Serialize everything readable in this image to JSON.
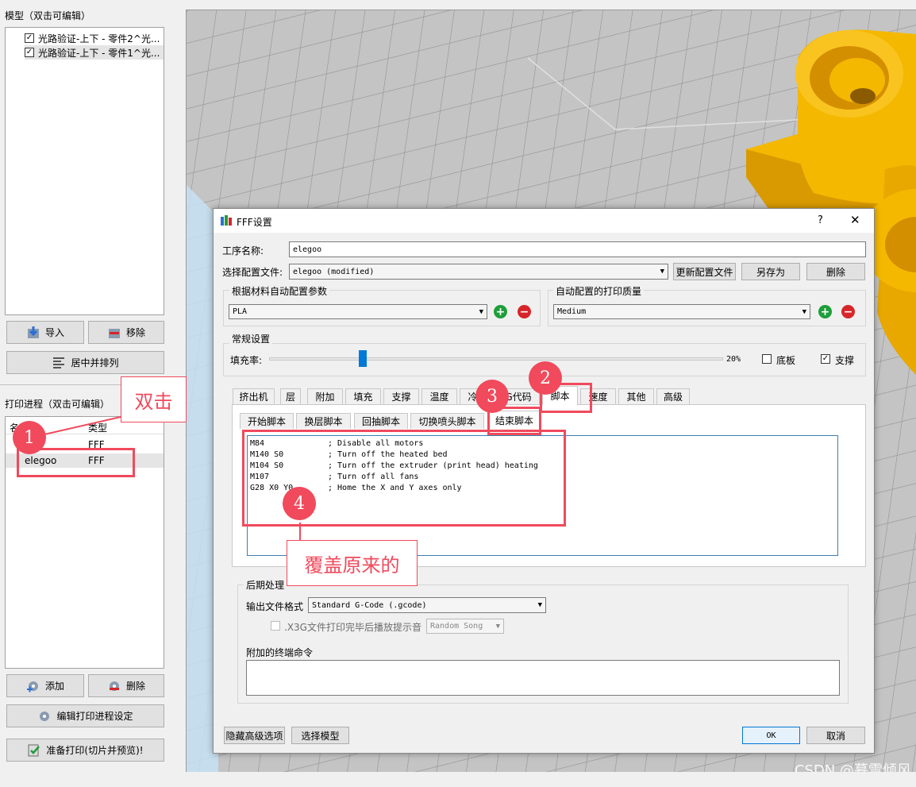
{
  "left": {
    "models_title": "模型（双击可编辑）",
    "models": [
      {
        "label": "光路验证-上下 - 零件2^光...",
        "checked": "✓"
      },
      {
        "label": "光路验证-上下 - 零件1^光...",
        "checked": "✓"
      }
    ],
    "import_label": "导入",
    "remove_label": "移除",
    "center_arrange_label": "居中并排列",
    "process_title": "打印进程（双击可编辑）",
    "process_columns": [
      "名",
      "类型"
    ],
    "processes": [
      {
        "name": "",
        "type": "FFF"
      },
      {
        "name": "elegoo",
        "type": "FFF"
      }
    ],
    "add_label": "添加",
    "delete_label": "删除",
    "edit_process_label": "编辑打印进程设定",
    "prepare_print_label": "准备打印(切片并预览)!"
  },
  "dialog": {
    "title": "FFF设置",
    "help": "?",
    "close": "✕",
    "process_name_label": "工序名称:",
    "process_name_value": "elegoo",
    "config_label": "选择配置文件:",
    "config_value": "elegoo (modified)",
    "update_config_label": "更新配置文件",
    "save_as_label": "另存为",
    "delete_label": "删除",
    "material_group": "根据材料自动配置参数",
    "material_value": "PLA",
    "quality_group": "自动配置的打印质量",
    "quality_value": "Medium",
    "general_group": "常规设置",
    "infill_label": "填充率:",
    "infill_slider_fraction": 0.206,
    "infill_value": "20%",
    "raft_label": "底板",
    "raft_checked": "",
    "support_label": "支撑",
    "support_checked": "✓",
    "main_tabs": [
      "挤出机",
      "层",
      "附加",
      "填充",
      "支撑",
      "温度",
      "冷却",
      "G代码",
      "脚本",
      "速度",
      "其他",
      "高级"
    ],
    "script_tabs": [
      "开始脚本",
      "换层脚本",
      "回抽脚本",
      "切换喷头脚本",
      "结束脚本"
    ],
    "script_lines": [
      {
        "cmd": "M84",
        "comment": "; Disable all motors"
      },
      {
        "cmd": "M140 S0",
        "comment": "; Turn off the heated bed"
      },
      {
        "cmd": "M104 S0",
        "comment": "; Turn off the extruder (print head) heating"
      },
      {
        "cmd": "M107",
        "comment": "; Turn off all fans"
      },
      {
        "cmd": "G28 X0 Y0",
        "comment": "; Home the X and Y axes only"
      }
    ],
    "post_group": "后期处理",
    "output_format_label": "输出文件格式",
    "output_format_value": "Standard G-Code (.gcode)",
    "x3g_label": ".X3G文件打印完毕后播放提示音",
    "x3g_song": "Random Song",
    "extra_cmd_label": "附加的终端命令",
    "extra_cmd_value": "",
    "hide_advanced_label": "隐藏高级选项",
    "select_model_label": "选择模型",
    "ok_label": "OK",
    "cancel_label": "取消"
  },
  "annotations": {
    "double_click": "双击",
    "overwrite": "覆盖原来的",
    "n1": "1",
    "n2": "2",
    "n3": "3",
    "n4": "4"
  },
  "watermark": "CSDN @暮雪倾风",
  "colors": {
    "annotation": "#f04a5c",
    "model_yellow": "#f5b800",
    "plus_green": "#1e9e3a",
    "minus_red": "#d6262a"
  }
}
